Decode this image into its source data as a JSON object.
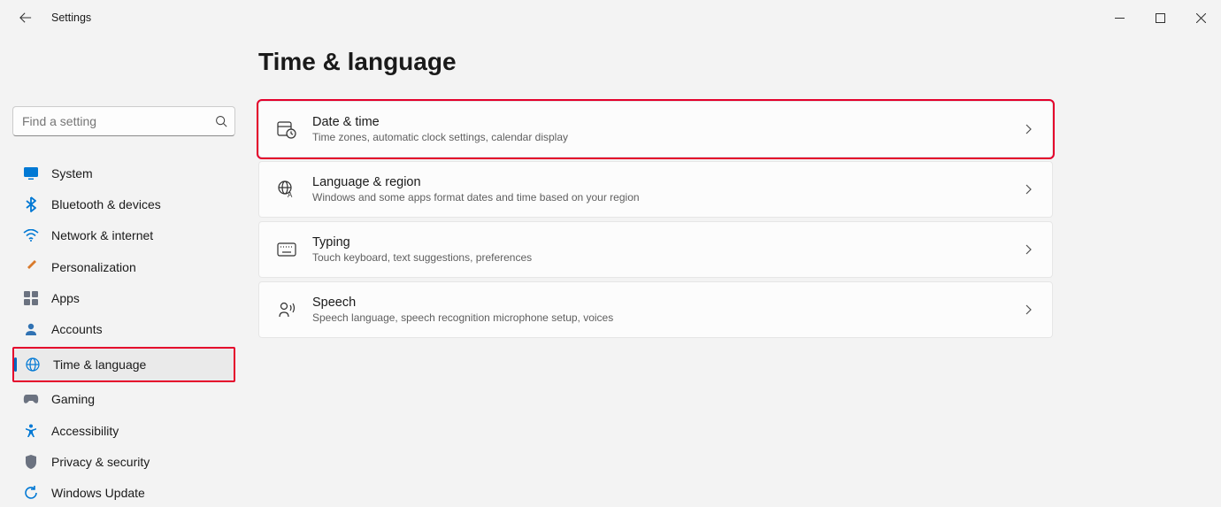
{
  "titlebar": {
    "app_title": "Settings"
  },
  "search": {
    "placeholder": "Find a setting"
  },
  "sidebar": {
    "items": [
      {
        "label": "System"
      },
      {
        "label": "Bluetooth & devices"
      },
      {
        "label": "Network & internet"
      },
      {
        "label": "Personalization"
      },
      {
        "label": "Apps"
      },
      {
        "label": "Accounts"
      },
      {
        "label": "Time & language"
      },
      {
        "label": "Gaming"
      },
      {
        "label": "Accessibility"
      },
      {
        "label": "Privacy & security"
      },
      {
        "label": "Windows Update"
      }
    ]
  },
  "page": {
    "title": "Time & language",
    "cards": [
      {
        "title": "Date & time",
        "subtitle": "Time zones, automatic clock settings, calendar display"
      },
      {
        "title": "Language & region",
        "subtitle": "Windows and some apps format dates and time based on your region"
      },
      {
        "title": "Typing",
        "subtitle": "Touch keyboard, text suggestions, preferences"
      },
      {
        "title": "Speech",
        "subtitle": "Speech language, speech recognition microphone setup, voices"
      }
    ]
  }
}
